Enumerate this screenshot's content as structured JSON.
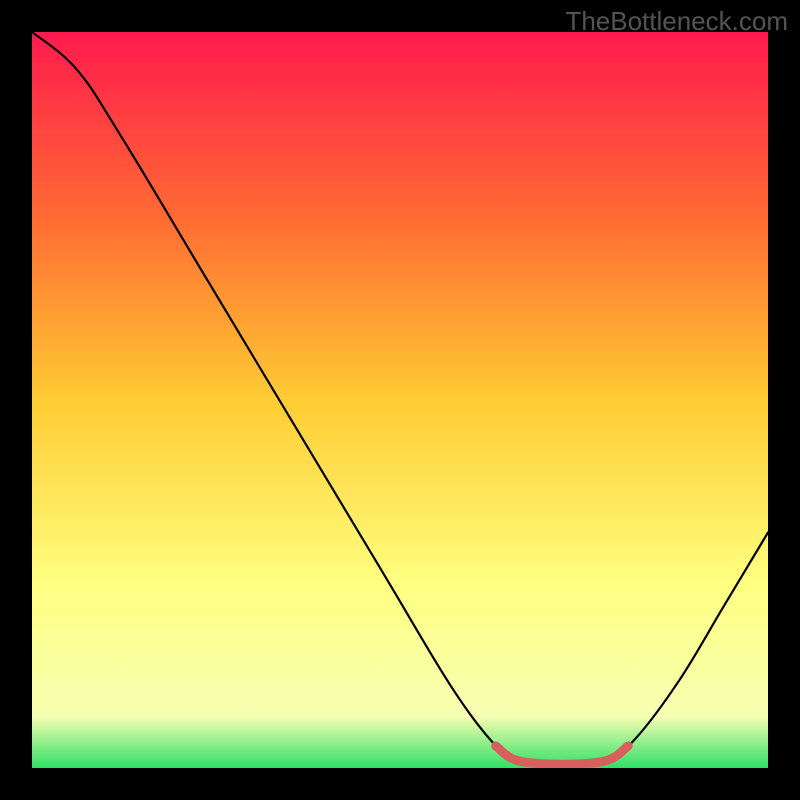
{
  "watermark": "TheBottleneck.com",
  "chart_data": {
    "type": "line",
    "title": "",
    "xlabel": "",
    "ylabel": "",
    "xlim": [
      0,
      100
    ],
    "ylim": [
      0,
      100
    ],
    "background_gradient": {
      "top": "#ff1a4d",
      "mid_upper": "#ff7a33",
      "mid": "#ffd633",
      "mid_lower": "#ffff66",
      "bottom": "#33e066"
    },
    "series": [
      {
        "name": "main-curve",
        "color": "#000000",
        "points": [
          {
            "x": 0,
            "y": 100
          },
          {
            "x": 6,
            "y": 95
          },
          {
            "x": 12,
            "y": 86
          },
          {
            "x": 24,
            "y": 66
          },
          {
            "x": 36,
            "y": 46
          },
          {
            "x": 48,
            "y": 26
          },
          {
            "x": 57,
            "y": 11
          },
          {
            "x": 63,
            "y": 3
          },
          {
            "x": 66,
            "y": 1
          },
          {
            "x": 72,
            "y": 0.5
          },
          {
            "x": 78,
            "y": 1
          },
          {
            "x": 82,
            "y": 4
          },
          {
            "x": 88,
            "y": 12
          },
          {
            "x": 94,
            "y": 22
          },
          {
            "x": 100,
            "y": 32
          }
        ]
      },
      {
        "name": "highlight-segment",
        "color": "#d95f5f",
        "width": 8,
        "points": [
          {
            "x": 63,
            "y": 3
          },
          {
            "x": 66,
            "y": 1
          },
          {
            "x": 72,
            "y": 0.5
          },
          {
            "x": 78,
            "y": 1
          },
          {
            "x": 81,
            "y": 3
          }
        ]
      }
    ]
  }
}
